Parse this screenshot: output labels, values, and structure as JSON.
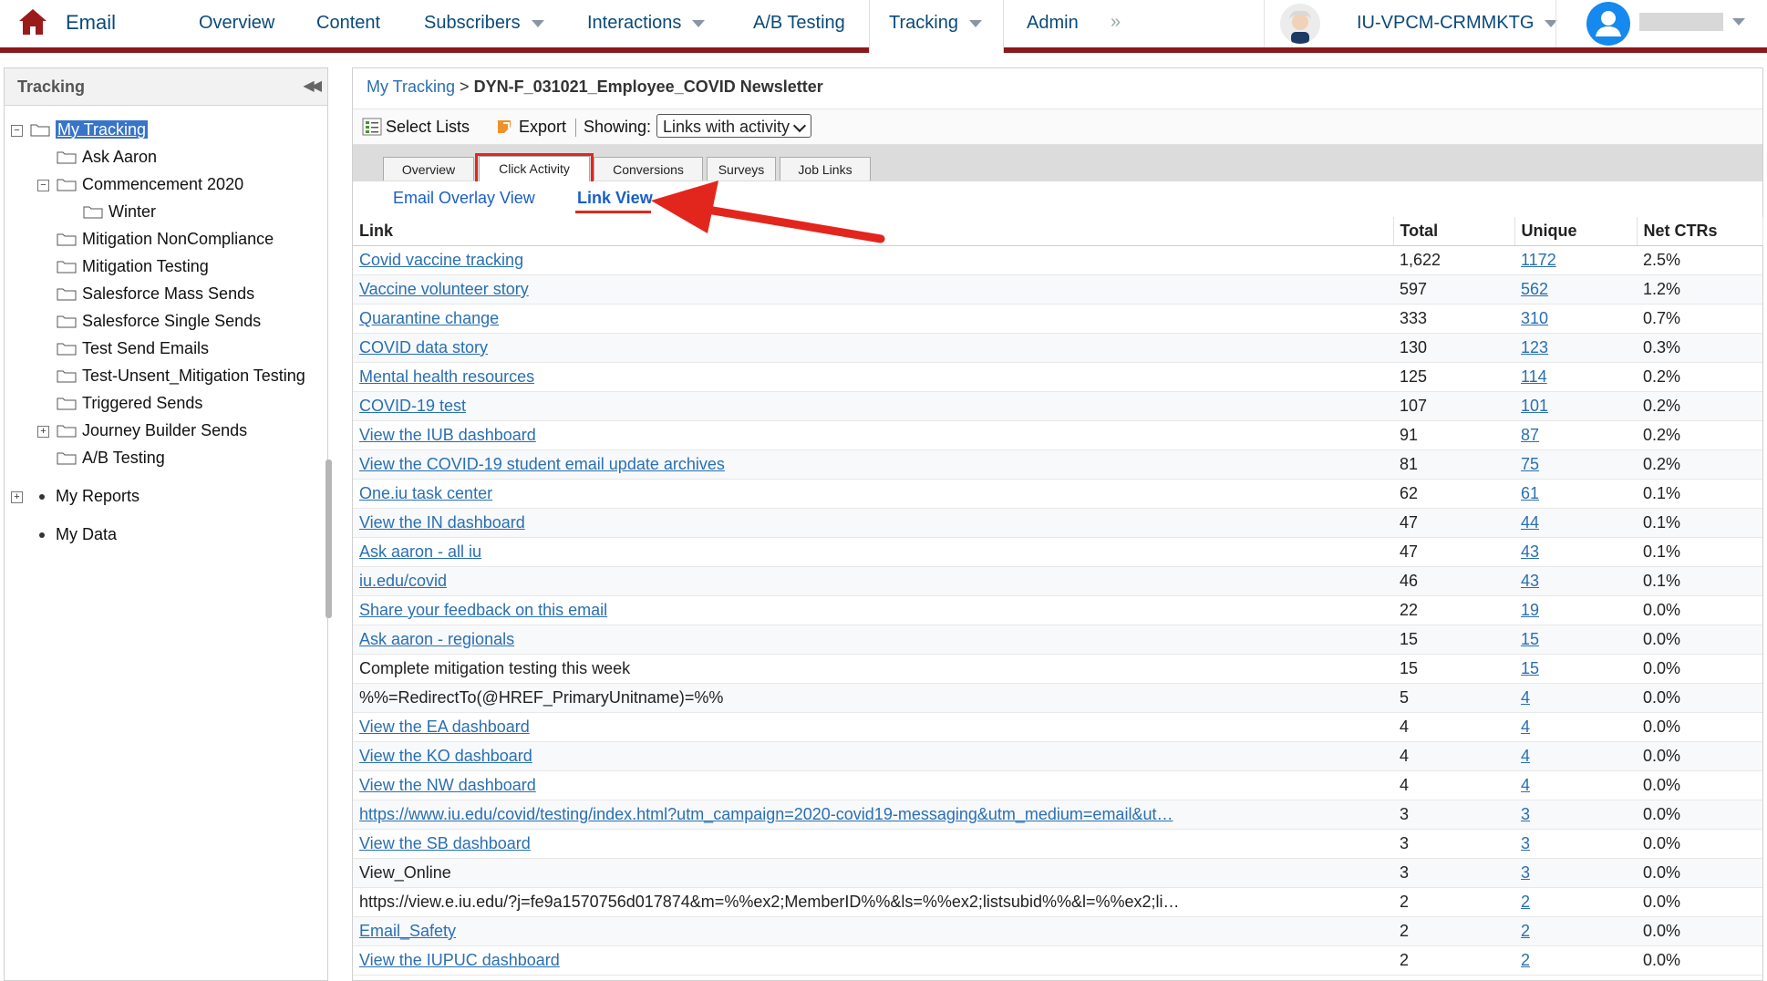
{
  "topnav": {
    "app": "Email",
    "items": [
      "Overview",
      "Content",
      "Subscribers",
      "Interactions",
      "A/B Testing",
      "Tracking",
      "Admin"
    ],
    "more": "»",
    "org": "IU-VPCM-CRMMKTG"
  },
  "sidebar": {
    "title": "Tracking",
    "tree": [
      "My Tracking",
      "Ask Aaron",
      "Commencement 2020",
      "Winter",
      "Mitigation NonCompliance",
      "Mitigation Testing",
      "Salesforce Mass Sends",
      "Salesforce Single Sends",
      "Test Send Emails",
      "Test-Unsent_Mitigation Testing",
      "Triggered Sends",
      "Journey Builder Sends",
      "A/B Testing"
    ],
    "extra": [
      "My Reports",
      "My Data"
    ]
  },
  "breadcrumb": {
    "root": "My Tracking",
    "sep": ">",
    "current": "DYN-F_031021_Employee_COVID Newsletter"
  },
  "toolbar": {
    "select_lists": "Select Lists",
    "export": "Export",
    "showing_label": "Showing:",
    "showing_value": "Links with activity"
  },
  "tabs": [
    "Overview",
    "Click Activity",
    "Conversions",
    "Surveys",
    "Job Links"
  ],
  "subviews": [
    "Email Overlay View",
    "Link View"
  ],
  "table": {
    "headers": [
      "Link",
      "Total",
      "Unique",
      "Net CTRs"
    ],
    "rows": [
      {
        "link": "Covid vaccine tracking",
        "is_link": true,
        "total": "1,622",
        "unique": "1172",
        "ctr": "2.5%"
      },
      {
        "link": "Vaccine volunteer story",
        "is_link": true,
        "total": "597",
        "unique": "562",
        "ctr": "1.2%"
      },
      {
        "link": "Quarantine change",
        "is_link": true,
        "total": "333",
        "unique": "310",
        "ctr": "0.7%"
      },
      {
        "link": "COVID data story",
        "is_link": true,
        "total": "130",
        "unique": "123",
        "ctr": "0.3%"
      },
      {
        "link": "Mental health resources",
        "is_link": true,
        "total": "125",
        "unique": "114",
        "ctr": "0.2%"
      },
      {
        "link": "COVID-19 test",
        "is_link": true,
        "total": "107",
        "unique": "101",
        "ctr": "0.2%"
      },
      {
        "link": "View the IUB dashboard",
        "is_link": true,
        "total": "91",
        "unique": "87",
        "ctr": "0.2%"
      },
      {
        "link": "View the COVID-19 student email update archives",
        "is_link": true,
        "total": "81",
        "unique": "75",
        "ctr": "0.2%"
      },
      {
        "link": "One.iu task center",
        "is_link": true,
        "total": "62",
        "unique": "61",
        "ctr": "0.1%"
      },
      {
        "link": "View the IN dashboard",
        "is_link": true,
        "total": "47",
        "unique": "44",
        "ctr": "0.1%"
      },
      {
        "link": "Ask aaron - all iu",
        "is_link": true,
        "total": "47",
        "unique": "43",
        "ctr": "0.1%"
      },
      {
        "link": "iu.edu/covid",
        "is_link": true,
        "total": "46",
        "unique": "43",
        "ctr": "0.1%"
      },
      {
        "link": "Share your feedback on this email",
        "is_link": true,
        "total": "22",
        "unique": "19",
        "ctr": "0.0%"
      },
      {
        "link": "Ask aaron - regionals",
        "is_link": true,
        "total": "15",
        "unique": "15",
        "ctr": "0.0%"
      },
      {
        "link": "Complete mitigation testing this week",
        "is_link": false,
        "total": "15",
        "unique": "15",
        "ctr": "0.0%"
      },
      {
        "link": "%%=RedirectTo(@HREF_PrimaryUnitname)=%%",
        "is_link": false,
        "total": "5",
        "unique": "4",
        "ctr": "0.0%"
      },
      {
        "link": "View the EA dashboard",
        "is_link": true,
        "total": "4",
        "unique": "4",
        "ctr": "0.0%"
      },
      {
        "link": "View the KO dashboard",
        "is_link": true,
        "total": "4",
        "unique": "4",
        "ctr": "0.0%"
      },
      {
        "link": "View the NW dashboard",
        "is_link": true,
        "total": "4",
        "unique": "4",
        "ctr": "0.0%"
      },
      {
        "link": "https://www.iu.edu/covid/testing/index.html?utm_campaign=2020-covid19-messaging&utm_medium=email&ut…",
        "is_link": true,
        "total": "3",
        "unique": "3",
        "ctr": "0.0%"
      },
      {
        "link": "View the SB dashboard",
        "is_link": true,
        "total": "3",
        "unique": "3",
        "ctr": "0.0%"
      },
      {
        "link": "View_Online",
        "is_link": false,
        "total": "3",
        "unique": "3",
        "ctr": "0.0%"
      },
      {
        "link": "https://view.e.iu.edu/?j=fe9a1570756d017874&m=%%ex2;MemberID%%&ls=%%ex2;listsubid%%&l=%%ex2;li…",
        "is_link": false,
        "total": "2",
        "unique": "2",
        "ctr": "0.0%"
      },
      {
        "link": "Email_Safety",
        "is_link": true,
        "total": "2",
        "unique": "2",
        "ctr": "0.0%"
      },
      {
        "link": "View the IUPUC dashboard",
        "is_link": true,
        "total": "2",
        "unique": "2",
        "ctr": "0.0%"
      }
    ]
  },
  "colors": {
    "brand_red": "#8a1a1a",
    "link_blue": "#2a6fb2",
    "highlight_red": "#e3261d",
    "selection_blue": "#3874c8"
  }
}
